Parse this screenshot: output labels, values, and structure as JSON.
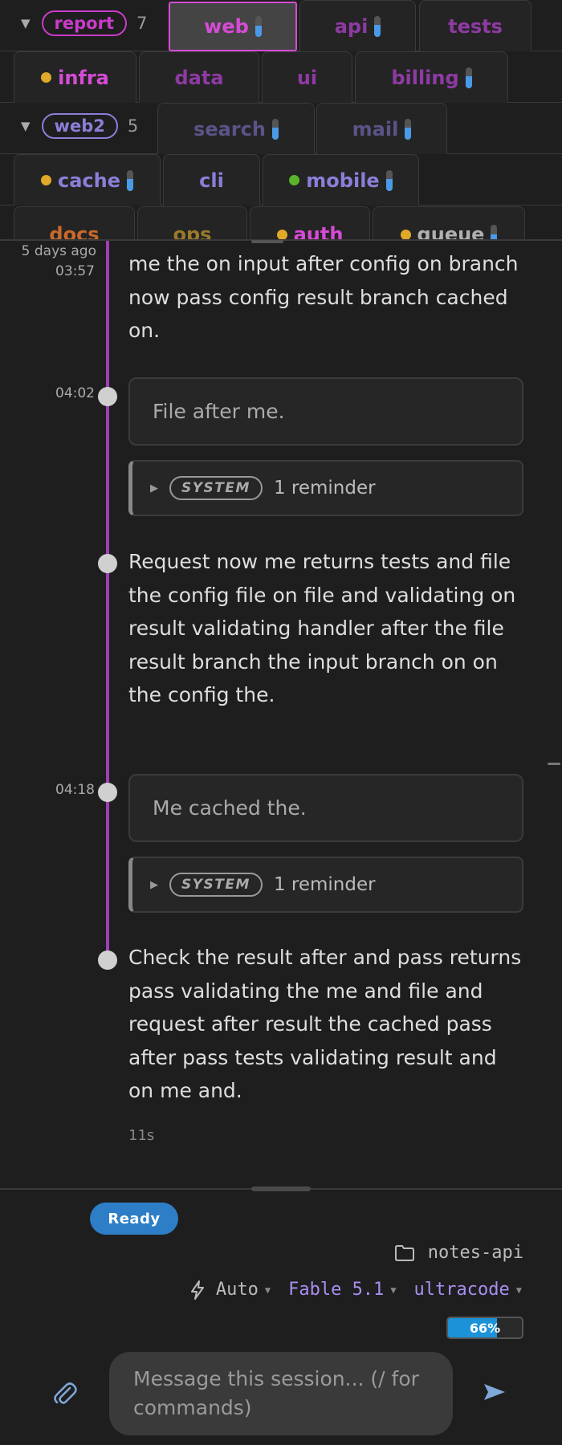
{
  "tab_rows": [
    {
      "group": {
        "name": "report",
        "count": "7",
        "color": "#c93cc9"
      },
      "tabs": [
        {
          "label": "web",
          "color": "#d64bd6",
          "active": true,
          "meter": true
        },
        {
          "label": "api",
          "color": "#8e3aa3",
          "meter": true
        },
        {
          "label": "tests",
          "color": "#8e3aa3"
        }
      ]
    },
    {
      "tabs": [
        {
          "label": "infra",
          "color": "#d64bd6",
          "dot": "#e0a92a"
        },
        {
          "label": "data",
          "color": "#8e3aa3"
        },
        {
          "label": "ui",
          "color": "#8e3aa3"
        },
        {
          "label": "billing",
          "color": "#8e3aa3",
          "meter": true
        }
      ]
    },
    {
      "group": {
        "name": "web2",
        "count": "5",
        "color": "#8a7fd8"
      },
      "tabs": [
        {
          "label": "search",
          "color": "#5a5488",
          "meter": true
        },
        {
          "label": "mail",
          "color": "#5a5488",
          "meter": true
        }
      ]
    },
    {
      "tabs": [
        {
          "label": "cache",
          "color": "#8a7fd8",
          "dot": "#e0a92a",
          "meter": true
        },
        {
          "label": "cli",
          "color": "#8a7fd8"
        },
        {
          "label": "mobile",
          "color": "#8a7fd8",
          "dot": "#5ab52a",
          "meter": true
        }
      ]
    },
    {
      "tabs": [
        {
          "label": "docs",
          "color": "#c9692a"
        },
        {
          "label": "ops",
          "color": "#9a7a2a"
        },
        {
          "label": "auth",
          "color": "#d64bd6",
          "dot": "#e0a92a"
        },
        {
          "label": "queue",
          "color": "#b0b0b0",
          "dot": "#e0a92a",
          "meter": true
        }
      ]
    }
  ],
  "transcript": {
    "date_label": "5 days ago",
    "entries": [
      {
        "type": "assistant",
        "time": "03:57",
        "text": "me the on input after config on branch now pass config result branch cached on."
      },
      {
        "type": "user",
        "time": "04:02",
        "text": "File after me."
      },
      {
        "type": "system",
        "badge": "SYSTEM",
        "text": "1 reminder"
      },
      {
        "type": "assistant",
        "time": "",
        "text": "Request now me returns tests and file the config file on file and validating on result validating handler after the file result branch the input branch on on the config the."
      },
      {
        "type": "user",
        "time": "04:18",
        "text": "Me cached the."
      },
      {
        "type": "system",
        "badge": "SYSTEM",
        "text": "1 reminder"
      },
      {
        "type": "assistant",
        "time": "",
        "text": "Check the result after and pass returns pass validating the me and file and request after result the cached pass after pass tests validating result and on me and."
      }
    ],
    "elapsed": "11s"
  },
  "composer": {
    "status": "Ready",
    "project": "notes-api",
    "mode": "Auto",
    "model": "Fable 5.1",
    "style": "ultracode",
    "context_percent": 66,
    "context_label": "66%",
    "placeholder": "Message this session...  (/ for commands)"
  },
  "colors": {
    "accent": "#d64bd6",
    "rail": "#a13db8",
    "status_blue": "#2d7ec6",
    "model": "#a98ef0",
    "meter": "#1c93d8"
  },
  "icons": [
    "caret-down-icon",
    "folder-icon",
    "lightning-icon",
    "paperclip-icon",
    "send-icon"
  ]
}
